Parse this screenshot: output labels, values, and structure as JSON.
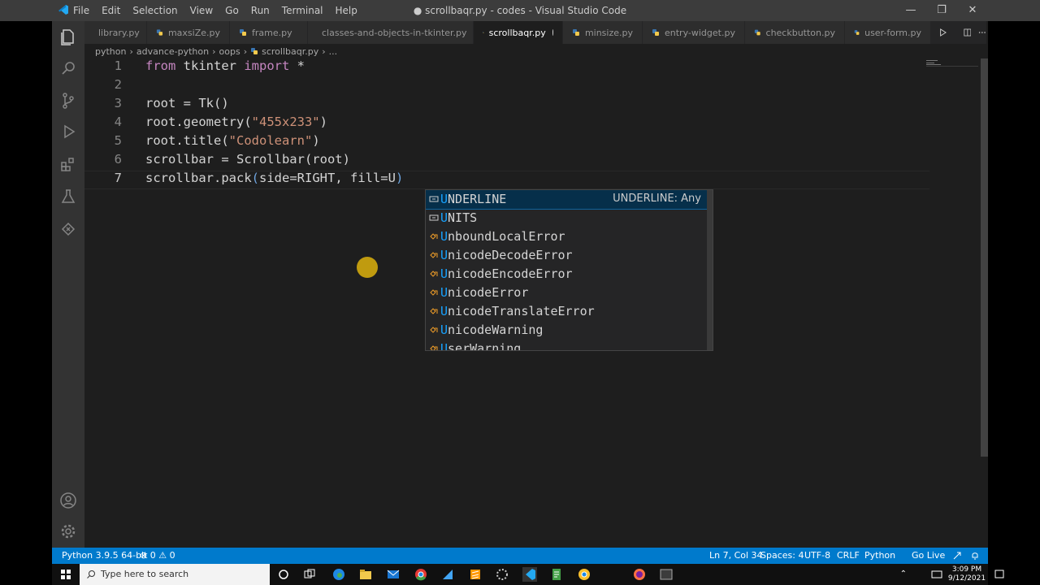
{
  "window": {
    "title": "● scrollbaqr.py - codes - Visual Studio Code",
    "menu": [
      "File",
      "Edit",
      "Selection",
      "View",
      "Go",
      "Run",
      "Terminal",
      "Help"
    ],
    "controls": [
      "—",
      "❐",
      "✕"
    ]
  },
  "tabs": [
    {
      "label": "library.py",
      "active": false
    },
    {
      "label": "maxsiZe.py",
      "active": false
    },
    {
      "label": "frame.py",
      "active": false
    },
    {
      "label": "classes-and-objects-in-tkinter.py",
      "active": false
    },
    {
      "label": "scrollbaqr.py",
      "active": true,
      "dirty": true
    },
    {
      "label": "minsize.py",
      "active": false
    },
    {
      "label": "entry-widget.py",
      "active": false
    },
    {
      "label": "checkbutton.py",
      "active": false
    },
    {
      "label": "user-form.py",
      "active": false
    }
  ],
  "breadcrumb": [
    "python",
    "advance-python",
    "oops",
    "scrollbaqr.py",
    "..."
  ],
  "code": {
    "line_numbers": [
      "1",
      "2",
      "3",
      "4",
      "5",
      "6",
      "7"
    ],
    "lines": [
      "from tkinter import *",
      "",
      "root = Tk()",
      "root.geometry(\"455x233\")",
      "root.title(\"Codolearn\")",
      "scrollbar = Scrollbar(root)",
      "scrollbar.pack(side=RIGHT, fill=U)"
    ]
  },
  "suggestions": {
    "items": [
      {
        "match": "U",
        "rest": "NDERLINE",
        "icon": "variable-icon",
        "detail": "UNDERLINE: Any"
      },
      {
        "match": "U",
        "rest": "NITS",
        "icon": "variable-icon",
        "detail": ""
      },
      {
        "match": "U",
        "rest": "nboundLocalError",
        "icon": "class-icon",
        "detail": ""
      },
      {
        "match": "U",
        "rest": "nicodeDecodeError",
        "icon": "class-icon",
        "detail": ""
      },
      {
        "match": "U",
        "rest": "nicodeEncodeError",
        "icon": "class-icon",
        "detail": ""
      },
      {
        "match": "U",
        "rest": "nicodeError",
        "icon": "class-icon",
        "detail": ""
      },
      {
        "match": "U",
        "rest": "nicodeTranslateError",
        "icon": "class-icon",
        "detail": ""
      },
      {
        "match": "U",
        "rest": "nicodeWarning",
        "icon": "class-icon",
        "detail": ""
      },
      {
        "match": "U",
        "rest": "serWarning",
        "icon": "class-icon",
        "detail": ""
      }
    ]
  },
  "status": {
    "interpreter": "Python 3.9.5 64-bit",
    "problems": "⊗ 0 ⚠ 0",
    "position": "Ln 7, Col 34",
    "spaces": "Spaces: 4",
    "encoding": "UTF-8",
    "eol": "CRLF",
    "language": "Python",
    "golive": "Go Live"
  },
  "taskbar": {
    "search_placeholder": "Type here to search",
    "time": "3:09 PM",
    "date": "9/12/2021"
  },
  "colors": {
    "accent": "#007acc",
    "keyword": "#c586c0",
    "string": "#ce9178",
    "suggest_match": "#18a3ff"
  }
}
